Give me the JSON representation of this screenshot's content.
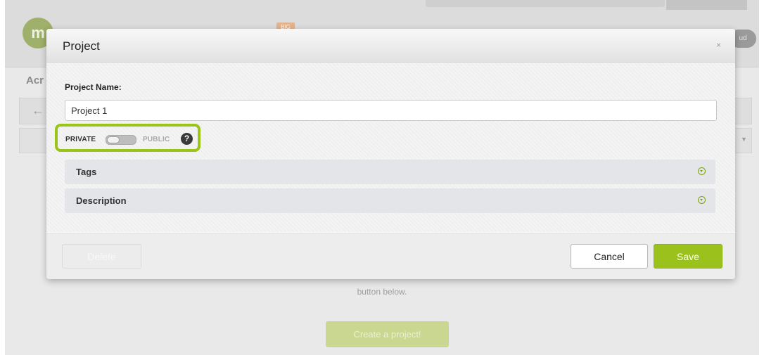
{
  "background": {
    "logo_text": "m",
    "badge_text": "BIG",
    "user_pill_text": "ud",
    "section_title": "Acr",
    "help_text": "button below.",
    "create_button": "Create a project!"
  },
  "modal": {
    "title": "Project",
    "close_glyph": "×",
    "name_label": "Project Name:",
    "name_value": "Project 1",
    "visibility": {
      "private_label": "PRIVATE",
      "public_label": "PUBLIC",
      "help_glyph": "?",
      "state": "private"
    },
    "sections": {
      "tags": "Tags",
      "description": "Description"
    },
    "buttons": {
      "delete": "Delete",
      "cancel": "Cancel",
      "save": "Save"
    }
  },
  "colors": {
    "accent": "#9ac11c",
    "highlight": "#9bc418"
  }
}
